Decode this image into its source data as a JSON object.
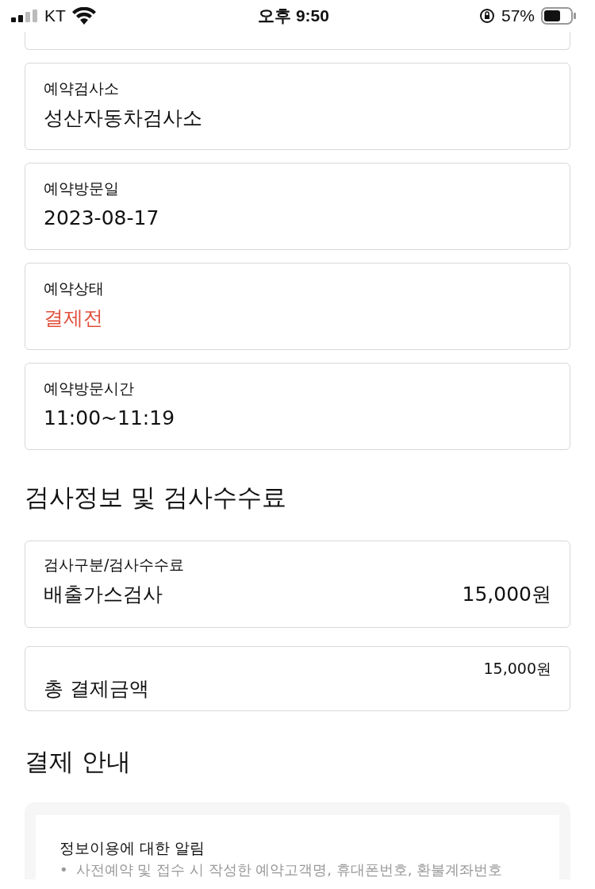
{
  "status_bar": {
    "carrier": "KT",
    "time": "오후 9:50",
    "battery": "57%"
  },
  "reservation_fields": [
    {
      "label": "예약검사소",
      "value": "성산자동차검사소",
      "kind": "text"
    },
    {
      "label": "예약방문일",
      "value": "2023-08-17",
      "kind": "text"
    },
    {
      "label": "예약상태",
      "value": "결제전",
      "kind": "status"
    },
    {
      "label": "예약방문시간",
      "value": "11:00~11:19",
      "kind": "text"
    }
  ],
  "fee_section": {
    "title": "검사정보 및 검사수수료",
    "fee_label": "검사구분/검사수수료",
    "items": [
      {
        "name": "배출가스검사",
        "amount": "15,000원"
      }
    ],
    "total_label": "총 결제금액",
    "total_amount": "15,000원"
  },
  "payment_section": {
    "title": "결제 안내",
    "notice_title": "정보이용에 대한 알림",
    "notice_items": [
      {
        "marker": "•",
        "text": "사전예약 및 접수 시 작성한 예약고객명, 휴대폰번호, 환불계좌번호"
      }
    ]
  }
}
